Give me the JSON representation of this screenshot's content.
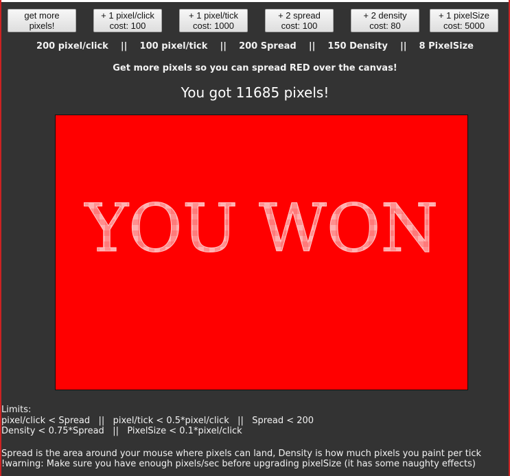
{
  "buttons": [
    {
      "line1": "get more",
      "line2": "pixels!"
    },
    {
      "line1": "+ 1 pixel/click",
      "line2": "cost: 100"
    },
    {
      "line1": "+ 1 pixel/tick",
      "line2": "cost: 1000"
    },
    {
      "line1": "+ 2 spread",
      "line2": "cost: 100"
    },
    {
      "line1": "+ 2 density",
      "line2": "cost: 80"
    },
    {
      "line1": "+ 1 pixelSize",
      "line2": "cost: 5000"
    }
  ],
  "stats": {
    "text": "200 pixel/click    ||    100 pixel/tick    ||    200 Spread    ||    150 Density    ||    8 PixelSize"
  },
  "hint": "Get more pixels so you can spread RED over the canvas!",
  "pixel_count": "You got 11685 pixels!",
  "canvas": {
    "win_text": "YOU WON",
    "color": "#ff0000",
    "text_color": "#ff9a9a"
  },
  "limits": {
    "title": "Limits:",
    "line1": "pixel/click < Spread   ||   pixel/tick < 0.5*pixel/click   ||   Spread < 200",
    "line2": "Density < 0.75*Spread   ||   PixelSize < 0.1*pixel/click"
  },
  "explanations": {
    "line1": "Spread is the area around your mouse where pixels can land, Density is how much pixels you paint per tick",
    "line2": "!warning: Make sure you have enough pixels/sec before upgrading pixelSize (it has some naughty effects)"
  }
}
